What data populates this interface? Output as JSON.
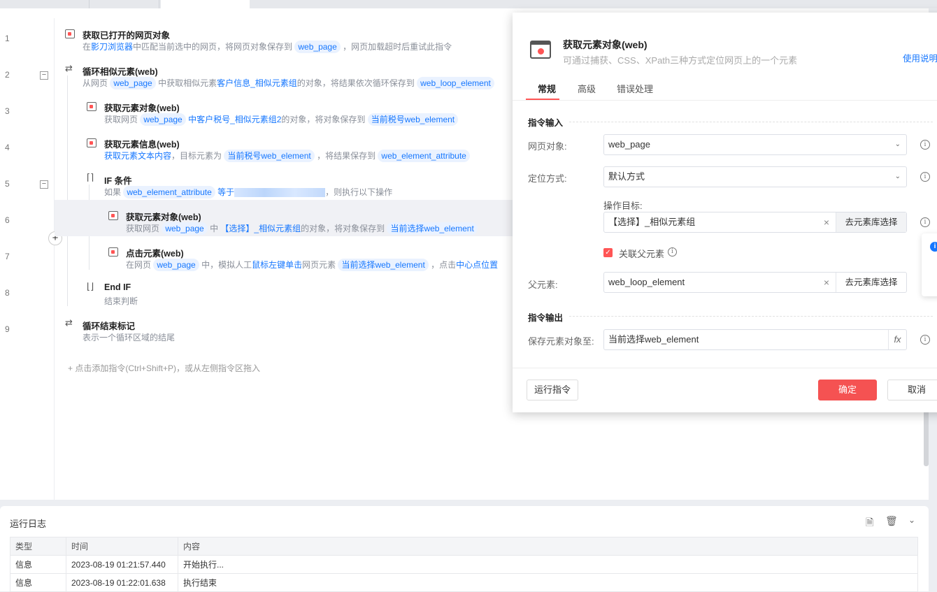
{
  "editor": {
    "rows": [
      {
        "num": "1",
        "title": "获取已打开的网页对象",
        "icon": "web-page-icon",
        "level": 0,
        "desc": [
          {
            "k": "text",
            "t": "在"
          },
          {
            "k": "link",
            "t": "影刀浏览器"
          },
          {
            "k": "text",
            "t": "中匹配当前选中的网页，将网页对象保存到 "
          },
          {
            "k": "chip",
            "t": "web_page"
          },
          {
            "k": "text",
            "t": " ，网页加载超时后重试此指令"
          }
        ]
      },
      {
        "num": "2",
        "title": "循环相似元素(web)",
        "icon": "loop-icon",
        "level": 0,
        "collapse": "−",
        "desc": [
          {
            "k": "text",
            "t": "从网页 "
          },
          {
            "k": "chip",
            "t": "web_page"
          },
          {
            "k": "text",
            "t": " 中获取相似元素"
          },
          {
            "k": "link",
            "t": "客户信息_相似元素组"
          },
          {
            "k": "text",
            "t": "的对象，将结果依次循环保存到 "
          },
          {
            "k": "chip",
            "t": "web_loop_element"
          }
        ]
      },
      {
        "num": "3",
        "title": "获取元素对象(web)",
        "icon": "web-element-icon",
        "level": 1,
        "desc": [
          {
            "k": "text",
            "t": "获取网页 "
          },
          {
            "k": "chip",
            "t": "web_page"
          },
          {
            "k": "link",
            "t": " 中客户税号_相似元素组2"
          },
          {
            "k": "text",
            "t": "的对象，将对象保存到 "
          },
          {
            "k": "chip",
            "t": "当前税号web_element"
          }
        ]
      },
      {
        "num": "4",
        "title": "获取元素信息(web)",
        "icon": "web-info-icon",
        "level": 1,
        "desc": [
          {
            "k": "link",
            "t": "获取元素文本内容"
          },
          {
            "k": "text",
            "t": "，目标元素为 "
          },
          {
            "k": "chip",
            "t": "当前税号web_element"
          },
          {
            "k": "text",
            "t": " ，将结果保存到 "
          },
          {
            "k": "chip",
            "t": "web_element_attribute"
          }
        ]
      },
      {
        "num": "5",
        "title": "IF 条件",
        "icon": "if-icon",
        "level": 1,
        "collapse": "−",
        "desc": [
          {
            "k": "text",
            "t": "如果 "
          },
          {
            "k": "chip",
            "t": "web_element_attribute"
          },
          {
            "k": "link",
            "t": " 等于"
          },
          {
            "k": "blur",
            "t": ""
          },
          {
            "k": "text",
            "t": "，则执行以下操作"
          }
        ]
      },
      {
        "num": "6",
        "title": "获取元素对象(web)",
        "icon": "web-element-icon",
        "level": 2,
        "selected": true,
        "desc": [
          {
            "k": "text",
            "t": "获取网页 "
          },
          {
            "k": "chip",
            "t": "web_page"
          },
          {
            "k": "text",
            "t": " 中 "
          },
          {
            "k": "link",
            "t": "【选择】_相似元素组"
          },
          {
            "k": "text",
            "t": "的对象，将对象保存到 "
          },
          {
            "k": "chip",
            "t": "当前选择web_element"
          }
        ]
      },
      {
        "num": "7",
        "title": "点击元素(web)",
        "icon": "click-element-icon",
        "level": 2,
        "desc": [
          {
            "k": "text",
            "t": "在网页 "
          },
          {
            "k": "chip",
            "t": "web_page"
          },
          {
            "k": "text",
            "t": " 中，模拟人工"
          },
          {
            "k": "link",
            "t": "鼠标左键单击"
          },
          {
            "k": "text",
            "t": "网页元素 "
          },
          {
            "k": "chip",
            "t": "当前选择web_element"
          },
          {
            "k": "text",
            "t": " ，点击"
          },
          {
            "k": "link",
            "t": "中心点位置"
          }
        ]
      },
      {
        "num": "8",
        "title": "End IF",
        "icon": "end-if-icon",
        "level": 1,
        "desc": [
          {
            "k": "text",
            "t": "结束判断"
          }
        ]
      },
      {
        "num": "9",
        "title": "循环结束标记",
        "icon": "loop-end-icon",
        "level": 0,
        "desc": [
          {
            "k": "text",
            "t": "表示一个循环区域的结尾"
          }
        ]
      }
    ],
    "add_hint": "+ 点击添加指令(Ctrl+Shift+P)，或从左侧指令区拖入"
  },
  "dialog": {
    "title": "获取元素对象(web)",
    "subtitle": "可通过捕获、CSS、XPath三种方式定位网页上的一个元素",
    "help": "使用说明",
    "tabs": [
      "常规",
      "高级",
      "错误处理"
    ],
    "input_section": "指令输入",
    "output_section": "指令输出",
    "web_page_label": "网页对象:",
    "web_page_value": "web_page",
    "locate_label": "定位方式:",
    "locate_value": "默认方式",
    "target_label": "操作目标:",
    "target_value": "【选择】_相似元素组",
    "lib_button": "去元素库选择",
    "relate_parent_label": "关联父元素",
    "relate_parent_checked": true,
    "parent_label": "父元素:",
    "parent_value": "web_loop_element",
    "save_label": "保存元素对象至:",
    "save_value": "当前选择web_element",
    "fx": "fx",
    "run_button": "运行指令",
    "ok_button": "确定",
    "cancel_button": "取消"
  },
  "log": {
    "title": "运行日志",
    "columns": [
      "类型",
      "时间",
      "内容"
    ],
    "rows": [
      [
        "信息",
        "2023-08-19 01:21:57.440",
        "开始执行..."
      ],
      [
        "信息",
        "2023-08-19 01:22:01.638",
        "执行结束"
      ]
    ]
  },
  "colors": {
    "accent": "#f55252",
    "link": "#1677ff",
    "chip_bg": "#eaf2ff"
  }
}
